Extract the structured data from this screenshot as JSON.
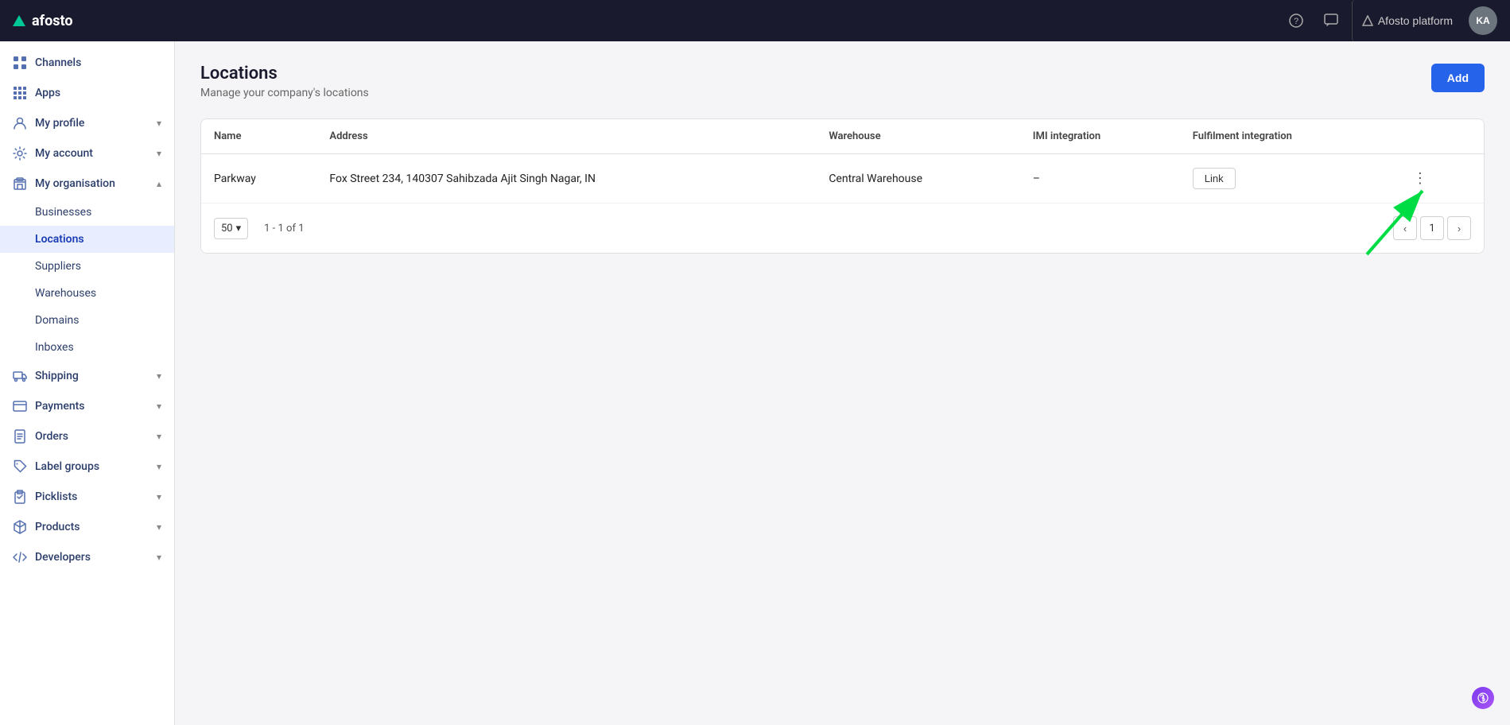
{
  "topbar": {
    "logo_text": "afosto",
    "platform_label": "Afosto platform",
    "avatar_initials": "KA",
    "help_icon": "?",
    "chat_icon": "💬"
  },
  "sidebar": {
    "items": [
      {
        "id": "channels",
        "label": "Channels",
        "icon": "grid",
        "has_chevron": false
      },
      {
        "id": "apps",
        "label": "Apps",
        "icon": "grid-small",
        "has_chevron": false
      },
      {
        "id": "my-profile",
        "label": "My profile",
        "icon": "person",
        "has_chevron": true
      },
      {
        "id": "my-account",
        "label": "My account",
        "icon": "gear",
        "has_chevron": true
      },
      {
        "id": "my-organisation",
        "label": "My organisation",
        "icon": "building",
        "has_chevron": true,
        "expanded": true
      },
      {
        "id": "businesses",
        "label": "Businesses",
        "sub": true
      },
      {
        "id": "locations",
        "label": "Locations",
        "sub": true,
        "active": true
      },
      {
        "id": "suppliers",
        "label": "Suppliers",
        "sub": true
      },
      {
        "id": "warehouses",
        "label": "Warehouses",
        "sub": true
      },
      {
        "id": "domains",
        "label": "Domains",
        "sub": true
      },
      {
        "id": "inboxes",
        "label": "Inboxes",
        "sub": true
      },
      {
        "id": "shipping",
        "label": "Shipping",
        "icon": "truck",
        "has_chevron": true
      },
      {
        "id": "payments",
        "label": "Payments",
        "icon": "card",
        "has_chevron": true
      },
      {
        "id": "orders",
        "label": "Orders",
        "icon": "doc",
        "has_chevron": true
      },
      {
        "id": "label-groups",
        "label": "Label groups",
        "icon": "tag",
        "has_chevron": true
      },
      {
        "id": "picklists",
        "label": "Picklists",
        "icon": "clipboard",
        "has_chevron": true
      },
      {
        "id": "products",
        "label": "Products",
        "icon": "box",
        "has_chevron": true
      },
      {
        "id": "developers",
        "label": "Developers",
        "icon": "code",
        "has_chevron": true
      }
    ]
  },
  "page": {
    "title": "Locations",
    "subtitle": "Manage your company's locations",
    "add_button": "Add"
  },
  "table": {
    "columns": [
      "Name",
      "Address",
      "Warehouse",
      "IMI integration",
      "Fulfilment integration"
    ],
    "rows": [
      {
        "name": "Parkway",
        "address": "Fox Street 234, 140307 Sahibzada Ajit Singh Nagar, IN",
        "warehouse": "Central Warehouse",
        "imi": "–",
        "fulfilment": "Link"
      }
    ]
  },
  "pagination": {
    "per_page": "50",
    "range": "1 - 1 of 1",
    "current_page": "1"
  }
}
